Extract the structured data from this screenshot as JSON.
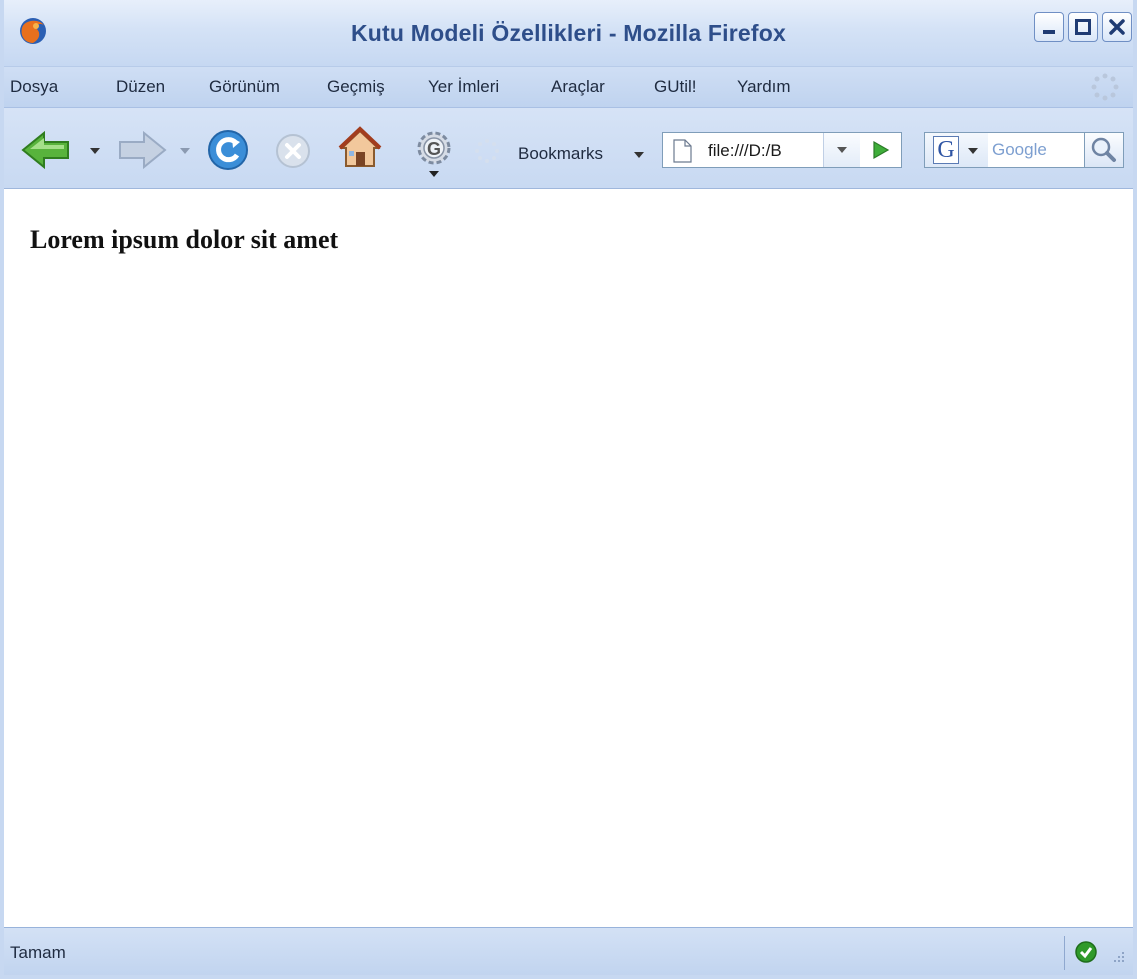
{
  "window": {
    "title": "Kutu Modeli Özellikleri - Mozilla Firefox"
  },
  "menu": {
    "items": [
      "Dosya",
      "Düzen",
      "Görünüm",
      "Geçmiş",
      "Yer İmleri",
      "Araçlar",
      "GUtil!",
      "Yardım"
    ]
  },
  "toolbar": {
    "bookmarks_label": "Bookmarks",
    "url": "file:///D:/B",
    "search_placeholder": "Google"
  },
  "content": {
    "heading": "Lorem ipsum dolor sit amet"
  },
  "status": {
    "text": "Tamam"
  },
  "colors": {
    "title_text": "#2e4e8a",
    "chrome_bg": "#c8d9f2",
    "page_bg": "#ffffff"
  },
  "icons": {
    "app": "firefox-icon",
    "back": "back-arrow-icon",
    "forward": "forward-arrow-icon",
    "reload": "reload-icon",
    "stop": "stop-icon",
    "home": "home-icon",
    "gutil": "gear-g-icon",
    "go": "go-arrow-icon",
    "search": "magnifier-icon",
    "status_ok": "check-circle-icon"
  }
}
